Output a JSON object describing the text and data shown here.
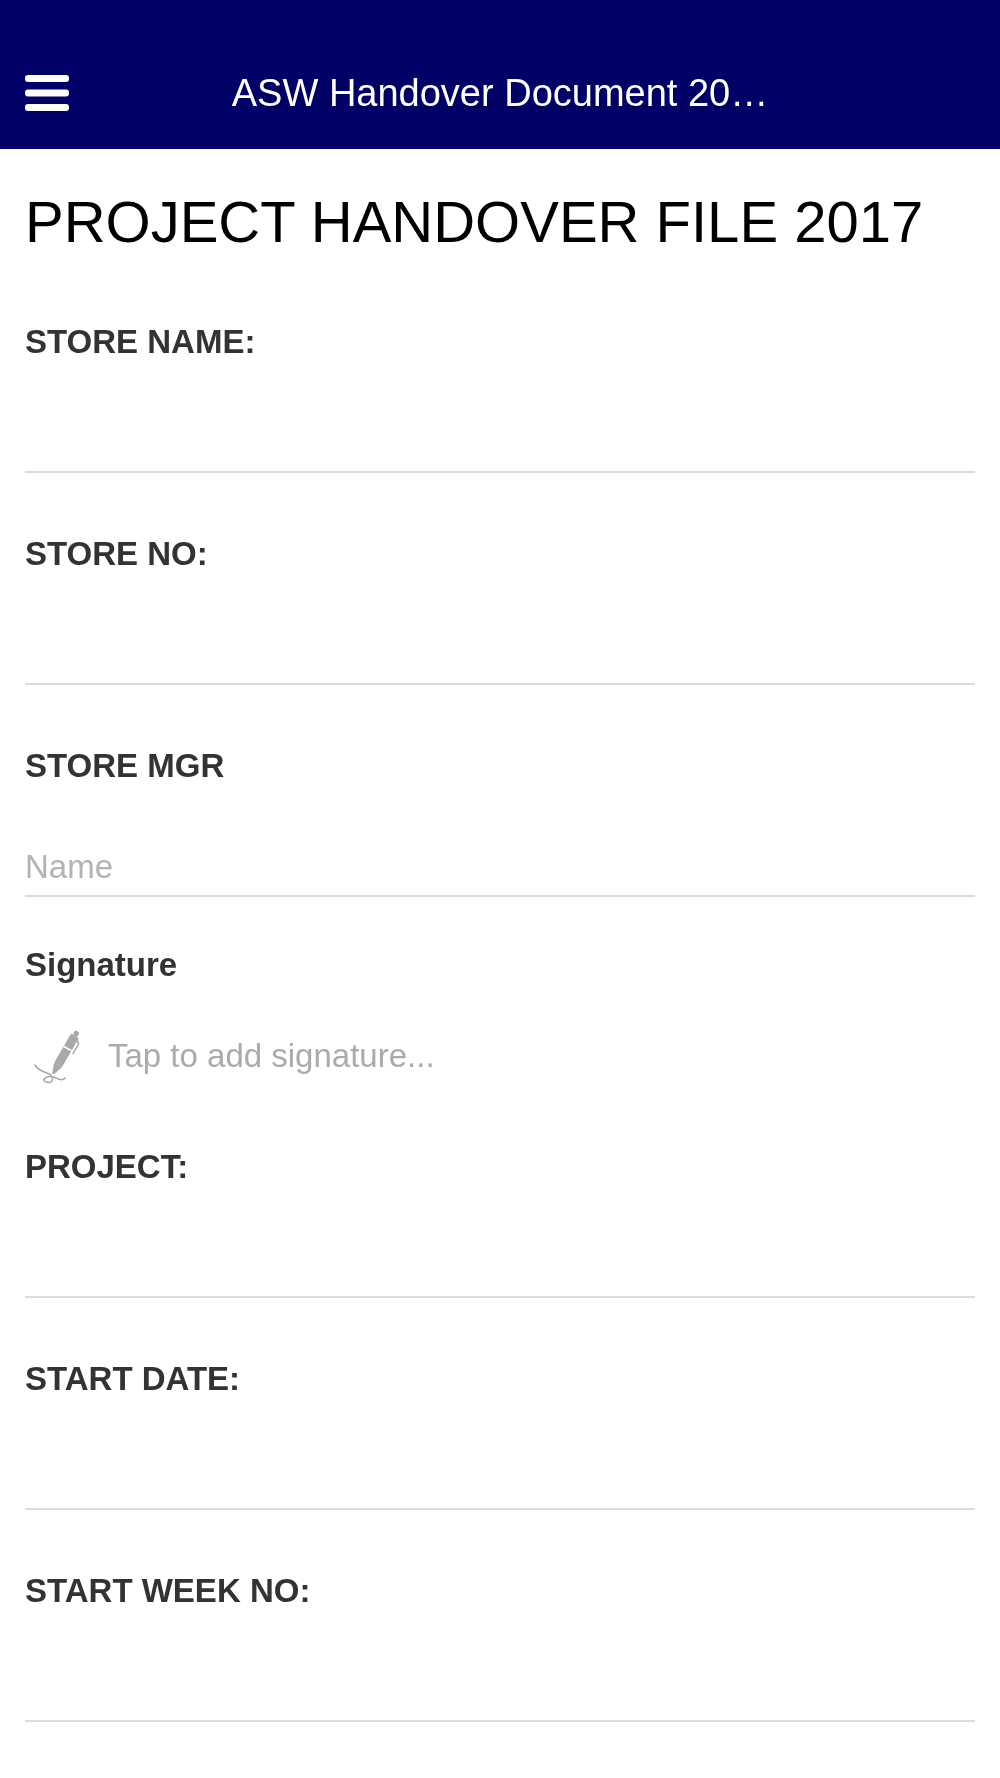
{
  "header": {
    "title": "ASW Handover Document 20…"
  },
  "heading": "PROJECT HANDOVER FILE 2017",
  "fields": [
    {
      "kind": "text",
      "label": "STORE NAME:"
    },
    {
      "kind": "text",
      "label": "STORE NO:"
    },
    {
      "kind": "signatory",
      "label": "STORE MGR",
      "placeholder": "Name",
      "signature_label": "Signature",
      "signature_prompt": "Tap to add signature..."
    },
    {
      "kind": "text",
      "label": "PROJECT:"
    },
    {
      "kind": "text",
      "label": "START DATE:"
    },
    {
      "kind": "text",
      "label": "START WEEK NO:"
    }
  ]
}
